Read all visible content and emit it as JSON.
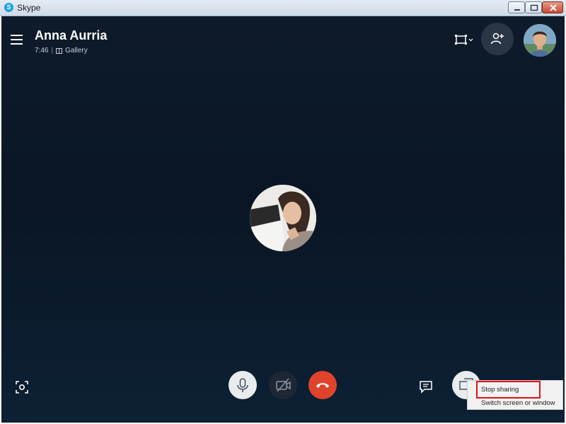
{
  "window": {
    "title": "Skype",
    "icon": "skype-logo-icon"
  },
  "call": {
    "contact_name": "Anna Aurria",
    "duration": "7:46",
    "separator": "|",
    "view_mode": "Gallery",
    "icons": {
      "menu": "hamburger-menu-icon",
      "layout": "layout-switch-icon",
      "add_participant": "add-person-icon",
      "snapshot": "snapshot-icon",
      "microphone": "microphone-icon",
      "video_off": "video-off-icon",
      "hang_up": "hang-up-icon",
      "chat": "chat-icon",
      "share_screen": "share-screen-icon"
    }
  },
  "share_menu": {
    "items": [
      "Stop sharing",
      "Switch screen or window"
    ]
  },
  "colors": {
    "background": "#0a1624",
    "hang_up": "#e0432c",
    "highlight": "#e0121a"
  }
}
